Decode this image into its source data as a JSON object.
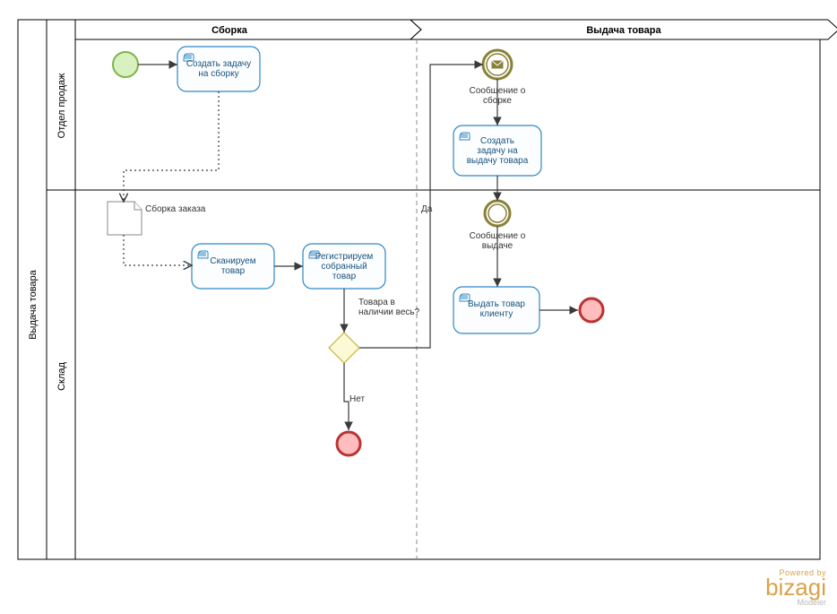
{
  "pool": {
    "name": "Выдача товара"
  },
  "lanes": {
    "sales": "Отдел продаж",
    "warehouse": "Склад"
  },
  "phases": {
    "assembly": "Сборка",
    "delivery": "Выдача товара"
  },
  "tasks": {
    "create_assembly": "Создать задачу|на сборку",
    "scan": "Сканируем|товар",
    "register": "Регистрируем|собранный|товар",
    "create_delivery": "Создать|задачу на|выдачу товара",
    "issue": "Выдать товар|клиенту"
  },
  "events": {
    "msg_assembly": "Сообщение о|сборке",
    "msg_issue": "Сообщение о|выдаче"
  },
  "artifacts": {
    "order_doc": "Сборка заказа"
  },
  "gateway": {
    "question": "Товара в|наличии весь?"
  },
  "labels": {
    "yes": "Да",
    "no": "Нет"
  },
  "branding": {
    "powered": "Powered by",
    "logo": "bizagi",
    "modeler": "Modeler"
  }
}
